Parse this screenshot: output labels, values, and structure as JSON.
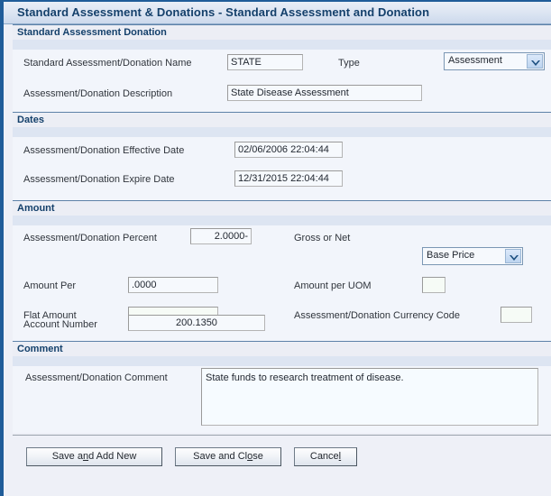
{
  "window": {
    "title": "Standard Assessment & Donations - Standard Assessment and Donation"
  },
  "colors": {
    "title_text": "#14406b",
    "section_text": "#14406b",
    "accent_border": "#1f5c99",
    "page_background": "#eef0f7",
    "section_body": "#f2f5fb",
    "input_background": "#f6f9fd"
  },
  "sections": [
    {
      "id": "standard-assessment-donation",
      "title": "Standard Assessment Donation",
      "fields": [
        {
          "id": "standard-assessment-donation-name",
          "label": "Standard Assessment/Donation Name",
          "value": "STATE",
          "placeholder": ""
        },
        {
          "id": "type",
          "label": "Type",
          "value": "Assessment",
          "control": "dropdown",
          "icon": "chevron-down-icon"
        },
        {
          "id": "assessment-donation-description",
          "label": "Assessment/Donation Description",
          "value": "State Disease Assessment",
          "placeholder": ""
        }
      ]
    },
    {
      "id": "dates",
      "title": "Dates",
      "fields": [
        {
          "id": "assessment-donation-effective-date",
          "label": "Assessment/Donation Effective Date",
          "value": "02/06/2006 22:04:44",
          "placeholder": ""
        },
        {
          "id": "assessment-donation-expire-date",
          "label": "Assessment/Donation Expire Date",
          "value": "12/31/2015 22:04:44",
          "placeholder": ""
        }
      ]
    },
    {
      "id": "amount",
      "title": "Amount",
      "fields": [
        {
          "id": "assessment-donation-percent",
          "label": "Assessment/Donation Percent",
          "value": "2.0000-",
          "placeholder": ""
        },
        {
          "id": "gross-or-net",
          "label": "Gross or Net",
          "value": "Base Price",
          "control": "dropdown",
          "icon": "chevron-down-icon"
        },
        {
          "id": "amount-per",
          "label": "Amount Per",
          "value": ".0000",
          "placeholder": ""
        },
        {
          "id": "amount-per-uom",
          "label": "Amount per UOM",
          "value": "",
          "placeholder": ""
        },
        {
          "id": "flat-amount",
          "label": "Flat Amount",
          "value": "",
          "placeholder": ""
        },
        {
          "id": "assessment-donation-currency-code",
          "label": "Assessment/Donation Currency Code",
          "value": "",
          "placeholder": ""
        },
        {
          "id": "account-number",
          "label": "Account Number",
          "value": "200.1350",
          "placeholder": ""
        }
      ]
    },
    {
      "id": "comment",
      "title": "Comment",
      "fields": [
        {
          "id": "assessment-donation-comment",
          "label": "Assessment/Donation Comment",
          "value": "State funds to research treatment of disease.",
          "placeholder": ""
        }
      ]
    }
  ],
  "buttons": {
    "save_and_add_new": {
      "before": "Save a",
      "accel": "n",
      "after": "d Add New",
      "full": "Save and Add New"
    },
    "save_and_close": {
      "before": "Save and Cl",
      "accel": "o",
      "after": "se",
      "full": "Save and Close"
    },
    "cancel": {
      "before": "Cance",
      "accel": "l",
      "after": "",
      "full": "Cancel"
    }
  }
}
